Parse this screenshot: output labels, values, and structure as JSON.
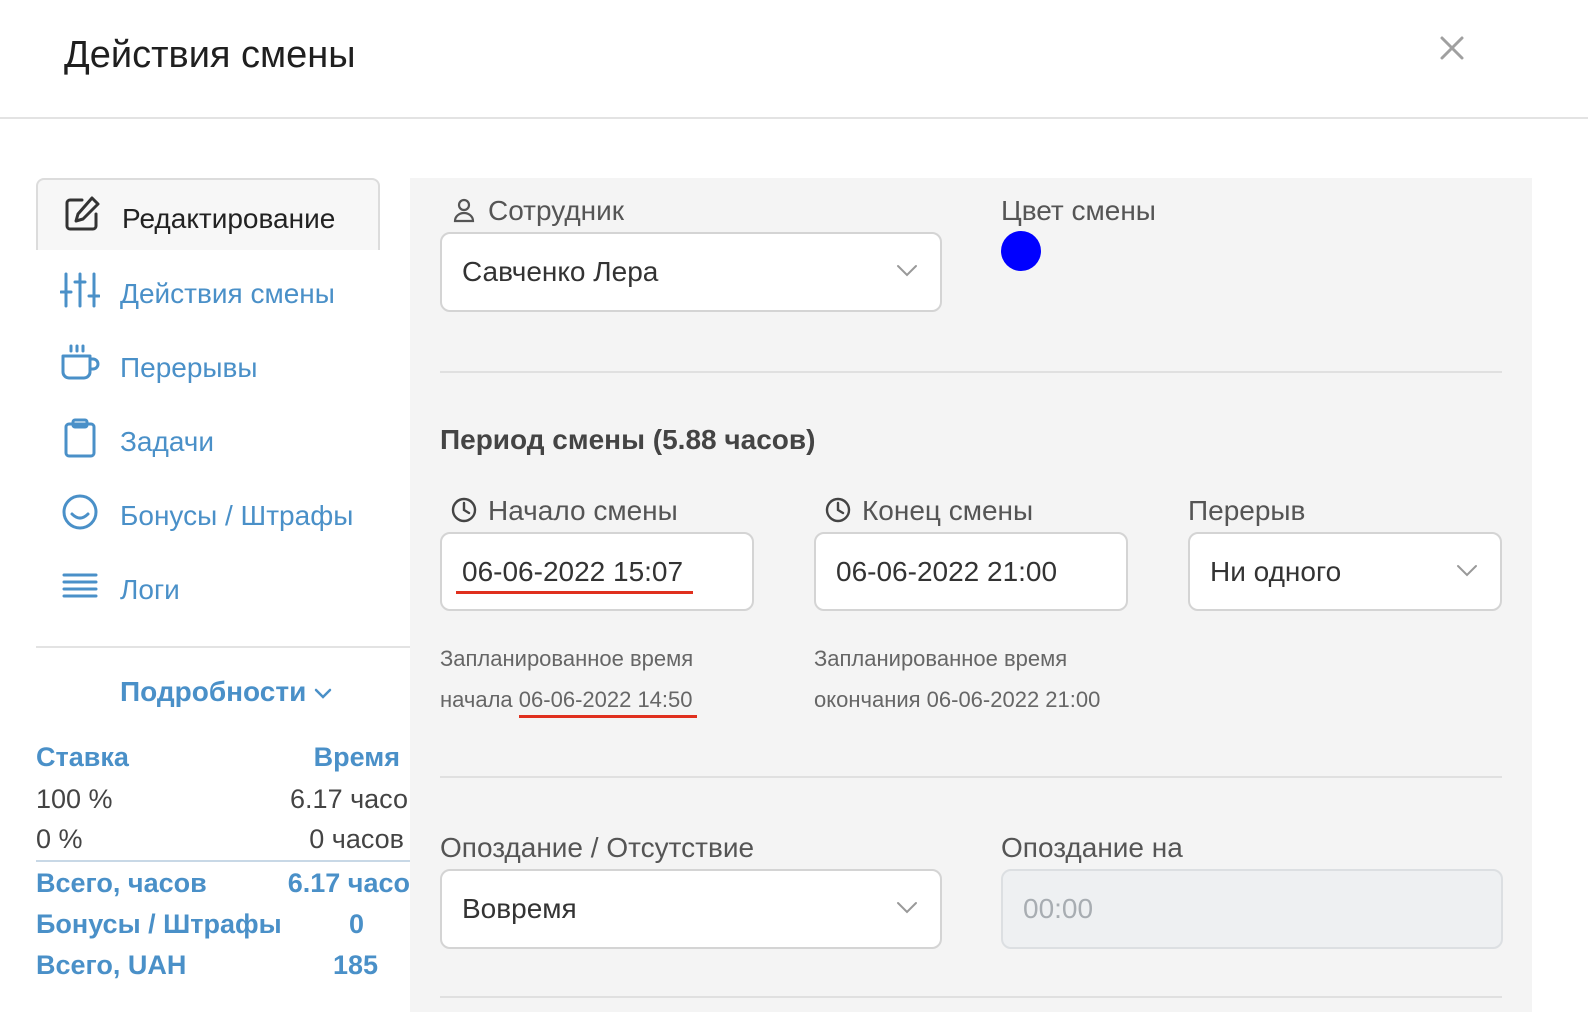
{
  "modal": {
    "title": "Действия смены"
  },
  "nav": [
    {
      "label": "Редактирование",
      "icon": "edit-icon",
      "active": true
    },
    {
      "label": "Действия смены",
      "icon": "sliders-icon"
    },
    {
      "label": "Перерывы",
      "icon": "coffee-cup-icon"
    },
    {
      "label": "Задачи",
      "icon": "clipboard-icon"
    },
    {
      "label": "Бонусы / Штрафы",
      "icon": "smile-icon"
    },
    {
      "label": "Логи",
      "icon": "list-lines-icon"
    }
  ],
  "details": {
    "toggle_label": "Подробности",
    "headers": {
      "rate": "Ставка",
      "time": "Время"
    },
    "rows": [
      {
        "rate": "100 %",
        "time": "6.17 часо"
      },
      {
        "rate": "0 %",
        "time": "0 часов"
      }
    ],
    "totals": [
      {
        "label": "Всего, часов",
        "value": "6.17 часо"
      },
      {
        "label": "Бонусы / Штрафы",
        "value": "0"
      },
      {
        "label": "Всего, UAH",
        "value": "185"
      }
    ]
  },
  "form": {
    "employee": {
      "label": "Сотрудник",
      "value": "Савченко Лера"
    },
    "shift_color": {
      "label": "Цвет смены",
      "color": "#0000ff"
    },
    "period": {
      "title": "Период смены (5.88 часов)",
      "start": {
        "label": "Начало смены",
        "value": "06-06-2022 15:07",
        "planned_line1": "Запланированное время",
        "planned_prefix": "начала",
        "planned_value": "06-06-2022 14:50"
      },
      "end": {
        "label": "Конец смены",
        "value": "06-06-2022 21:00",
        "planned_line1": "Запланированное время",
        "planned_line2": "окончания 06-06-2022 21:00"
      },
      "break": {
        "label": "Перерыв",
        "value": "Ни одного"
      }
    },
    "lateness": {
      "label": "Опоздание / Отсутствие",
      "value": "Вовремя",
      "late_by_label": "Опоздание на",
      "late_by_value": "00:00"
    }
  },
  "colors": {
    "accent": "#4a90c8",
    "highlight": "#e0301e",
    "panel_bg": "#f4f4f4"
  }
}
